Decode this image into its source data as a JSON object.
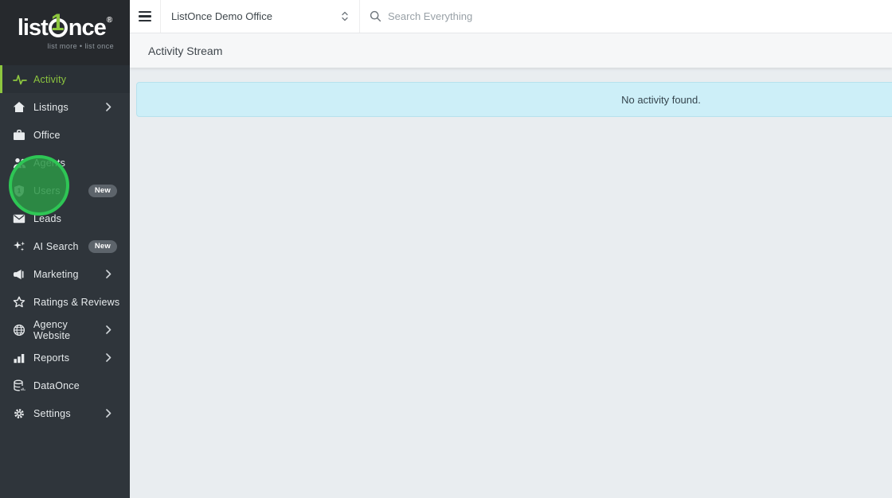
{
  "brand": {
    "logo_prefix": "list",
    "logo_one": "1",
    "logo_suffix": "nce",
    "registered": "®",
    "tagline": "list more • list once"
  },
  "topbar": {
    "office_selector": {
      "value": "ListOnce Demo Office",
      "icon": "up-down-chevron-icon"
    },
    "search": {
      "icon": "search-icon",
      "placeholder": "Search Everything",
      "value": ""
    }
  },
  "sidebar": {
    "items": [
      {
        "label": "Activity",
        "icon": "activity-pulse-icon",
        "active": true
      },
      {
        "label": "Listings",
        "icon": "house-icon",
        "chevron": true
      },
      {
        "label": "Office",
        "icon": "briefcase-icon"
      },
      {
        "label": "Agents",
        "icon": "people-icon"
      },
      {
        "label": "Users",
        "icon": "shield-icon",
        "badge": "New"
      },
      {
        "label": "Leads",
        "icon": "envelope-icon"
      },
      {
        "label": "AI Search",
        "icon": "sparkles-icon",
        "badge": "New"
      },
      {
        "label": "Marketing",
        "icon": "megaphone-icon",
        "chevron": true
      },
      {
        "label": "Ratings & Reviews",
        "icon": "star-icon"
      },
      {
        "label": "Agency Website",
        "icon": "globe-icon",
        "chevron": true
      },
      {
        "label": "Reports",
        "icon": "bar-chart-icon",
        "chevron": true
      },
      {
        "label": "DataOnce",
        "icon": "database-icon"
      },
      {
        "label": "Settings",
        "icon": "gear-icon",
        "chevron": true
      }
    ]
  },
  "page_header": {
    "title": "Activity Stream"
  },
  "content": {
    "alert": {
      "text": "No activity found."
    }
  },
  "annotation": {
    "shape": "circle",
    "meaning": "click-highlight",
    "target": "Users",
    "color": "#2ec655"
  },
  "colors": {
    "accent_green": "#8dc63f",
    "sidebar_bg": "#2f353b",
    "sidebar_header_bg": "#26292d",
    "alert_bg": "#cdeff8",
    "alert_border": "#b7e2ed"
  }
}
